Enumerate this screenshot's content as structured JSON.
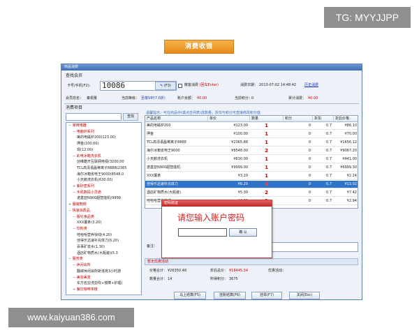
{
  "watermark_top": "TG: MYYJJPP",
  "watermark_bottom": "www.kaiyuan386.com",
  "banner": "消费收银",
  "window": {
    "title": "商品消费",
    "section_member": "查找会员",
    "card_label": "卡号/手机(F2):",
    "card_value": "10086",
    "f3_label": "(F3)",
    "anon_label": "散客消费",
    "anon_hint": "(回车Enter)",
    "date_label": "消费日期：",
    "date_value": "2013-07-02 14:48:42",
    "history_link": "历史消费",
    "member_name_label": "会员姓名：",
    "member_name": "秦炯量",
    "level_label": "当前等级：",
    "level_value": "至尊VIP(7.0折)",
    "balance_label": "账户余额：",
    "balance_value": "¥0.00",
    "points_label": "当前积分：",
    "points_value": "0",
    "total_label": "累计消费：",
    "total_value": "¥0.00",
    "section_items": "消费项目",
    "search_button": "查找",
    "tip": "温馨提示：可在商品中(或点击列表)选数量，折扣与积分可直接修改积分值",
    "tree": [
      {
        "text": "家用电器",
        "level": 0,
        "color": "#c00000",
        "sign": "−"
      },
      {
        "text": "电脑炉系列",
        "level": 1,
        "color": "#c00000",
        "sign": "−"
      },
      {
        "text": "美的电磁炉200(123.00)",
        "level": 2,
        "color": "#222"
      },
      {
        "text": "押金(100.00)",
        "level": 2,
        "color": "#222"
      },
      {
        "text": "现(12.00)",
        "level": 2,
        "color": "#222"
      },
      {
        "text": "彩电冰箱洗衣机",
        "level": 1,
        "color": "#c00000",
        "sign": "−"
      },
      {
        "text": "创维酷开互联网电视(3200.00",
        "level": 2,
        "color": "#222"
      },
      {
        "text": "TCL高清语晶等离子8888(2365",
        "level": 2,
        "color": "#222"
      },
      {
        "text": "海尔冰箱省电王9000(8548.0",
        "level": 2,
        "color": "#222"
      },
      {
        "text": "小天鹅洗衣机(630.00)",
        "level": 2,
        "color": "#222"
      },
      {
        "text": "紫砂壶系列",
        "level": 1,
        "color": "#c00000",
        "sign": "+"
      },
      {
        "text": "手机数码小灵通",
        "level": 1,
        "color": "#c00000",
        "sign": "−"
      },
      {
        "text": "诺基亚N900超智能机(9999",
        "level": 2,
        "color": "#222"
      },
      {
        "text": "服装鞋帽",
        "level": 0,
        "color": "#c00000",
        "sign": "+"
      },
      {
        "text": "快速消费品",
        "level": 0,
        "color": "#c00000",
        "sign": "−"
      },
      {
        "text": "服化食品类",
        "level": 1,
        "color": "#c00000",
        "sign": "−"
      },
      {
        "text": "XXX薯条(3.20)",
        "level": 2,
        "color": "#222"
      },
      {
        "text": "饮料类",
        "level": 1,
        "color": "#c00000",
        "sign": "−"
      },
      {
        "text": "哇哈哈营养快线(4.20)",
        "level": 2,
        "color": "#222"
      },
      {
        "text": "佳得乐迅速补充体力(6.20)",
        "level": 2,
        "color": "#222"
      },
      {
        "text": "百事矿泉水(1.30)",
        "level": 2,
        "color": "#222"
      },
      {
        "text": "酒店矿物质水(大瓶装)(5.3",
        "level": 2,
        "color": "#222"
      },
      {
        "text": "服务类",
        "level": 0,
        "color": "#c00000",
        "sign": "−"
      },
      {
        "text": "休闲会所",
        "level": 1,
        "color": "#c00000",
        "sign": "−"
      },
      {
        "text": "翻城休闲会所斯洛克3小时游",
        "level": 2,
        "color": "#222"
      },
      {
        "text": "美容美发",
        "level": 1,
        "color": "#c00000",
        "sign": "−"
      },
      {
        "text": "东方名剪洗剪吹+按摩+护理(",
        "level": 2,
        "color": "#222"
      },
      {
        "text": "餐饮咖啡茶楼",
        "level": 1,
        "color": "#c00000",
        "sign": "+"
      }
    ],
    "columns": [
      "产品名称",
      "单价",
      "数量",
      "积分",
      "折扣",
      "折后价格"
    ],
    "rows": [
      {
        "name": "美的电磁炉200",
        "price": "¥123.00",
        "qty": "1",
        "points": "0",
        "discount": "0.7",
        "final": "¥86.10",
        "selected": false
      },
      {
        "name": "押金",
        "price": "¥100.00",
        "qty": "1",
        "points": "0",
        "discount": "0.7",
        "final": "¥70.00",
        "selected": false
      },
      {
        "name": "TCL高清语晶等离子8888",
        "price": "¥2365.88",
        "qty": "1",
        "points": "0",
        "discount": "0.7",
        "final": "¥1656.12",
        "selected": false
      },
      {
        "name": "海尔冰箱省电王9000",
        "price": "¥8548.00",
        "qty": "2",
        "points": "0",
        "discount": "0.7",
        "final": "¥9067.20",
        "selected": false
      },
      {
        "name": "小天鹅洗衣机",
        "price": "¥630.00",
        "qty": "1",
        "points": "0",
        "discount": "0.7",
        "final": "¥441.00",
        "selected": false
      },
      {
        "name": "诺基亚N900超智能机",
        "price": "¥9999.00",
        "qty": "1",
        "points": "0",
        "discount": "0.7",
        "final": "¥6999.30",
        "selected": false
      },
      {
        "name": "XXX薯条",
        "price": "¥3.20",
        "qty": "1",
        "points": "0",
        "discount": "0.7",
        "final": "¥2.24",
        "selected": false
      },
      {
        "name": "佳得乐迅速补充体力",
        "price": "¥6.20",
        "qty": "3",
        "points": "0",
        "discount": "0.7",
        "final": "¥13.02",
        "selected": true
      },
      {
        "name": "酒店矿物质水(大瓶装)",
        "price": "¥5.30",
        "qty": "2",
        "points": "0",
        "discount": "0.7",
        "final": "¥7.42",
        "selected": false
      },
      {
        "name": "哇哈哈营养快线",
        "price": "¥4.20",
        "qty": "1",
        "points": "0",
        "discount": "0.7",
        "final": "¥2.94",
        "selected": false
      }
    ],
    "remark_label": "备注：",
    "promo": "暂无优惠活动",
    "summary": {
      "price_total_label": "价格合计：",
      "price_total": "¥26350.48",
      "discounted_label": "折后总价：",
      "discounted": "¥18445.34",
      "promo_label": "优惠活动：",
      "qty_total_label": "数量合计：",
      "qty_total": "14",
      "points_label": "所得积分：",
      "points": "3675"
    },
    "buttons": [
      {
        "label": "马上结算(F5)",
        "name": "settle-button"
      },
      {
        "label": "挂账结算(F6)",
        "name": "credit-settle-button"
      },
      {
        "label": "挂单(F7)",
        "name": "hold-order-button"
      },
      {
        "label": "关闭(Esc)",
        "name": "close-button"
      }
    ]
  },
  "dialog": {
    "title": "密码验证",
    "prompt": "请您输入账户密码",
    "ok": "确 认"
  }
}
